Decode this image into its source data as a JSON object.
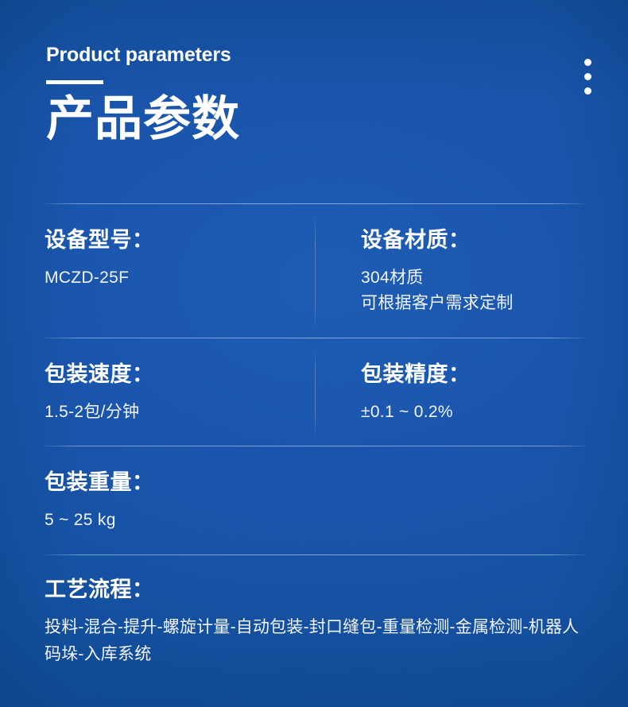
{
  "header": {
    "eyebrow": "Product parameters",
    "headline": "产品参数"
  },
  "menu": {
    "icon": "kebab-menu-icon",
    "dot_count": 3
  },
  "theme": {
    "background": "#1750a5",
    "text": "#ffffff",
    "value_text": "#f2f5fa",
    "divider": "rgba(255,255,255,0.45)"
  },
  "specs": [
    {
      "label": "设备型号：",
      "value_lines": [
        "MCZD-25F"
      ]
    },
    {
      "label": "设备材质：",
      "value_lines": [
        "304材质",
        "可根据客户需求定制"
      ]
    },
    {
      "label": "包装速度：",
      "value_lines": [
        "1.5-2包/分钟"
      ]
    },
    {
      "label": "包装精度：",
      "value_lines": [
        "±0.1 ~ 0.2%"
      ]
    },
    {
      "label": "包装重量：",
      "value_lines": [
        "5 ~ 25 kg"
      ]
    },
    {
      "label": "工艺流程：",
      "value_lines": [
        "投料-混合-提升-螺旋计量-自动包装-封口缝包-重量检测-金属检测-机器人码垛-入库系统"
      ]
    }
  ],
  "spec_fields": {
    "model_label": "设备型号：",
    "model_value": "MCZD-25F",
    "material_label": "设备材质：",
    "material_value_1": "304材质",
    "material_value_2": "可根据客户需求定制",
    "speed_label": "包装速度：",
    "speed_value": "1.5-2包/分钟",
    "accuracy_label": "包装精度：",
    "accuracy_value": "±0.1 ~ 0.2%",
    "weight_label": "包装重量：",
    "weight_value": "5 ~ 25 kg",
    "process_label": "工艺流程：",
    "process_value": "投料-混合-提升-螺旋计量-自动包装-封口缝包-重量检测-金属检测-机器人码垛-入库系统"
  }
}
